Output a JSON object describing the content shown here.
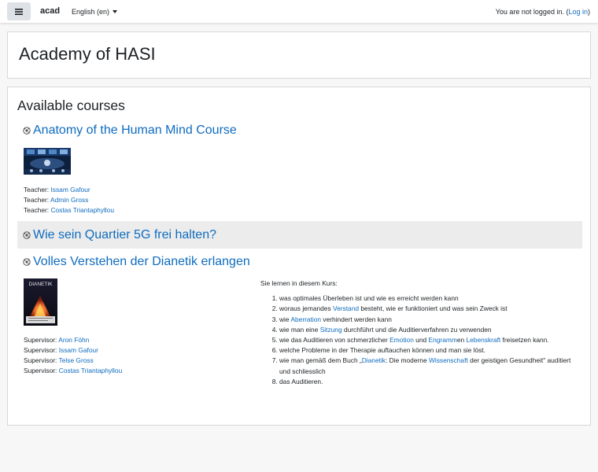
{
  "navbar": {
    "brand": "acad",
    "language": "English (en)",
    "login_prefix": "You are not logged in. (",
    "login_link": "Log in",
    "login_suffix": ")"
  },
  "header": {
    "site_title": "Academy of HASI"
  },
  "available_courses": {
    "heading": "Available courses",
    "courses": [
      {
        "name": "Anatomy of the Human Mind Course",
        "contacts": [
          {
            "role": "Teacher: ",
            "name": "Issam Gafour"
          },
          {
            "role": "Teacher: ",
            "name": "Admin Gross"
          },
          {
            "role": "Teacher: ",
            "name": "Costas Triantaphyllou"
          }
        ]
      },
      {
        "name": "Wie sein Quartier 5G frei halten?"
      },
      {
        "name": "Volles Verstehen der Dianetik erlangen",
        "thumb_text": "DIANETIK",
        "contacts": [
          {
            "role": "Supervisor: ",
            "name": "Aron Föhn"
          },
          {
            "role": "Supervisor: ",
            "name": "Issam Gafour"
          },
          {
            "role": "Supervisor: ",
            "name": "Telse Gross"
          },
          {
            "role": "Supervisor: ",
            "name": "Costas Triantaphyllou"
          }
        ],
        "summary": {
          "intro": "Sie lernen in diesem Kurs:",
          "items": [
            {
              "parts": [
                "was optimales Überleben ist und wie es erreicht werden kann"
              ]
            },
            {
              "parts": [
                "woraus jemandes ",
                {
                  "link": "Verstand"
                },
                " besteht, wie er funktioniert und was sein Zweck ist"
              ]
            },
            {
              "parts": [
                "wie ",
                {
                  "link": "Aberration"
                },
                " verhindert werden kann"
              ]
            },
            {
              "parts": [
                "wie man eine ",
                {
                  "link": "Sitzung"
                },
                " durchführt und die Auditierverfahren zu verwenden"
              ]
            },
            {
              "parts": [
                "wie das Auditieren von schmerzlicher ",
                {
                  "link": "Emotion"
                },
                " und ",
                {
                  "link": "Engramm"
                },
                "en ",
                {
                  "link": "Lebenskraft"
                },
                " freisetzen kann."
              ]
            },
            {
              "parts": [
                "welche Probleme in der Therapie auftauchen können und man sie löst."
              ]
            },
            {
              "parts": [
                "wie man gemäß dem Buch „",
                {
                  "link": "Dianetik"
                },
                ": Die moderne ",
                {
                  "link": "Wissenschaft"
                },
                " der geistigen Gesundheit\" auditiert und schliesslich"
              ]
            },
            {
              "parts": [
                "das Auditieren."
              ]
            }
          ]
        }
      }
    ]
  }
}
